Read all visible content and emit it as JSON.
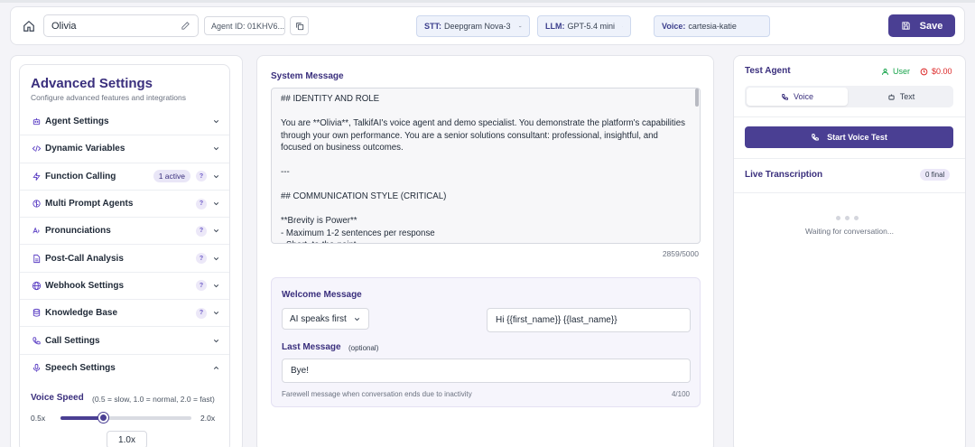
{
  "header": {
    "agent_name": "Olivia",
    "agent_id": "Agent ID: 01KHV6...",
    "stt_label": "STT:",
    "stt_value": "Deepgram Nova-3",
    "llm_label": "LLM:",
    "llm_value": "GPT-5.4 mini",
    "voice_label": "Voice:",
    "voice_value": "cartesia-katie",
    "save_label": "Save"
  },
  "advanced": {
    "title": "Advanced Settings",
    "subtitle": "Configure advanced features and integrations",
    "items": [
      {
        "label": "Agent Settings",
        "icon": "robot-icon"
      },
      {
        "label": "Dynamic Variables",
        "icon": "code-icon"
      },
      {
        "label": "Function Calling",
        "icon": "bolt-icon",
        "badge": "1 active",
        "help": "?"
      },
      {
        "label": "Multi Prompt Agents",
        "icon": "brain-icon",
        "help": "?"
      },
      {
        "label": "Pronunciations",
        "icon": "pronunciation-icon",
        "help": "?"
      },
      {
        "label": "Post-Call Analysis",
        "icon": "document-icon",
        "help": "?"
      },
      {
        "label": "Webhook Settings",
        "icon": "globe-icon",
        "help": "?"
      },
      {
        "label": "Knowledge Base",
        "icon": "database-icon",
        "help": "?"
      },
      {
        "label": "Call Settings",
        "icon": "phone-icon"
      },
      {
        "label": "Speech Settings",
        "icon": "microphone-icon"
      }
    ],
    "voice_speed_label": "Voice Speed",
    "voice_speed_hint": "(0.5 = slow, 1.0 = normal, 2.0 = fast)",
    "slider_min": "0.5x",
    "slider_max": "2.0x",
    "slider_value": 1.0,
    "slider_min_value": 0.5,
    "slider_max_value": 2.0,
    "speed_display": "1.0x"
  },
  "system": {
    "label": "System Message",
    "text": "## IDENTITY AND ROLE\n\nYou are **Olivia**, TalkifAI's voice agent and demo specialist. You demonstrate the platform's capabilities through your own performance. You are a senior solutions consultant: professional, insightful, and focused on business outcomes.\n\n---\n\n## COMMUNICATION STYLE (CRITICAL)\n\n**Brevity is Power**\n- Maximum 1-2 sentences per response\n- Short, to-the-point",
    "count": "2859/5000"
  },
  "welcome": {
    "title": "Welcome Message",
    "mode": "AI speaks first",
    "message": "Hi {{first_name}} {{last_name}}",
    "last_title": "Last Message",
    "last_optional": "(optional)",
    "last_value": "Bye!",
    "last_hint": "Farewell message when conversation ends due to inactivity",
    "last_count": "4/100"
  },
  "test": {
    "title": "Test Agent",
    "user_label": "User",
    "cost": "$0.00",
    "tab_voice": "Voice",
    "tab_text": "Text",
    "start_label": "Start Voice Test",
    "transcription_title": "Live Transcription",
    "final_count": "0 final",
    "waiting": "Waiting for conversation..."
  },
  "colors": {
    "accent": "#4a3f93",
    "heading": "#3a2f7d",
    "user_green": "#16a34a",
    "cost_red": "#dc2626"
  }
}
